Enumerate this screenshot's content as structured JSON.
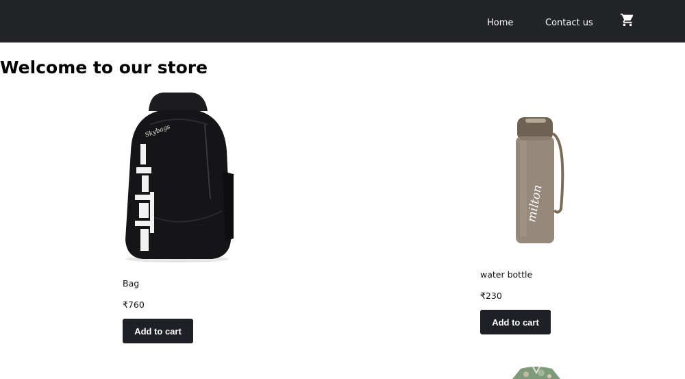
{
  "nav": {
    "links": [
      {
        "label": "Home"
      },
      {
        "label": "Contact us"
      }
    ],
    "cart_icon": "shopping-cart-icon"
  },
  "page": {
    "title": "Welcome to our store"
  },
  "products": [
    {
      "name": "Bag",
      "price": "₹760",
      "button_label": "Add to cart",
      "image_icon": "backpack-image"
    },
    {
      "name": "water bottle",
      "price": "₹230",
      "button_label": "Add to cart",
      "image_icon": "water-bottle-image"
    },
    {
      "image_icon": "shirt-image"
    }
  ],
  "colors": {
    "navbar_bg": "#232428",
    "button_bg": "#1f2026",
    "button_text": "#ffffff"
  }
}
